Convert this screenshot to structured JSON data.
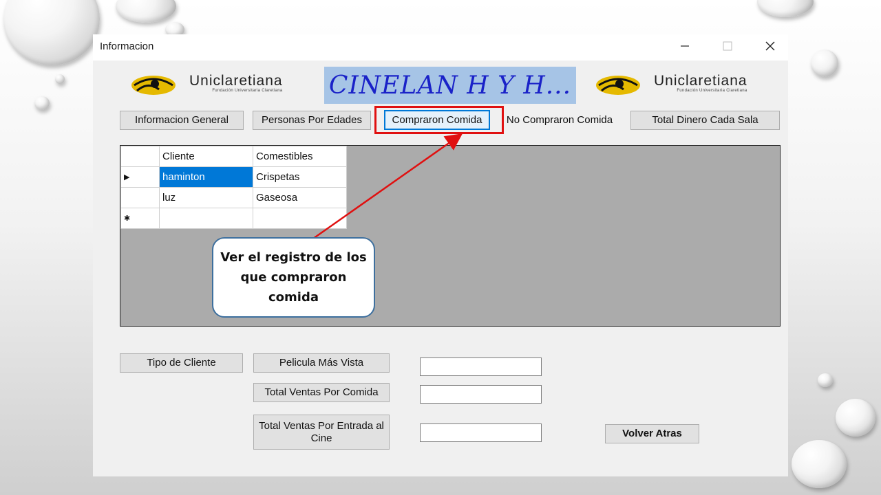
{
  "window": {
    "title": "Informacion"
  },
  "header": {
    "logo_left": {
      "name": "Uniclaretiana",
      "sub": "Fundación Universitaria Claretiana"
    },
    "banner": "CINELAN H Y H...",
    "logo_right": {
      "name": "Uniclaretiana",
      "sub": "Fundación Universitaria Claretiana"
    }
  },
  "tabs": {
    "general": "Informacion General",
    "edades": "Personas Por Edades",
    "compraron": "Compraron Comida",
    "no_compraron": "No Compraron Comida",
    "total_sala": "Total Dinero Cada Sala"
  },
  "table": {
    "columns": [
      "Cliente",
      "Comestibles"
    ],
    "rows": [
      {
        "indicator": "▶",
        "cliente": "haminton",
        "comestibles": "Crispetas"
      },
      {
        "indicator": "",
        "cliente": "luz",
        "comestibles": "Gaseosa"
      },
      {
        "indicator": "✱",
        "cliente": "",
        "comestibles": ""
      }
    ]
  },
  "callout": {
    "text": "Ver el registro de los que compraron comida"
  },
  "bottom": {
    "tipo_cliente": "Tipo de Cliente",
    "pelicula": "Pelicula Más Vista",
    "ventas_comida": "Total Ventas Por Comida",
    "ventas_entrada": "Total Ventas Por Entrada al Cine",
    "volver": "Volver Atras"
  },
  "colors": {
    "accent": "#0078d7",
    "highlight": "#e01010",
    "banner_bg": "#a6c4e6",
    "banner_text": "#1a22c8"
  }
}
